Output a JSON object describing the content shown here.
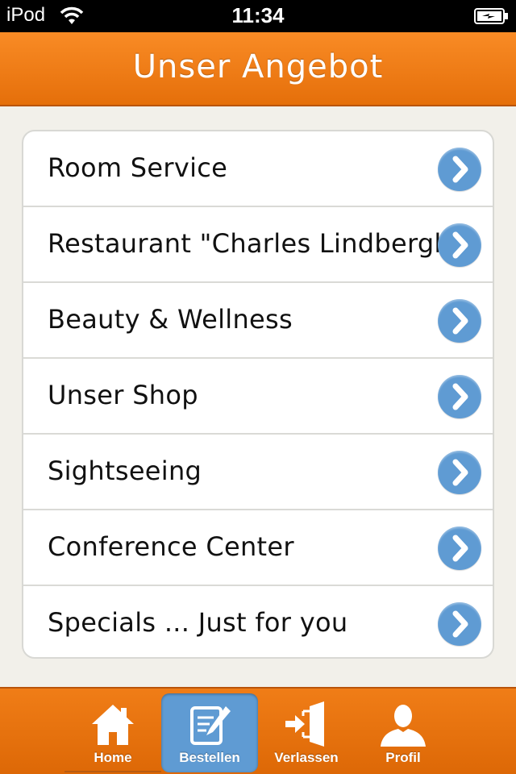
{
  "status_bar": {
    "device": "iPod",
    "time": "11:34"
  },
  "nav": {
    "title": "Unser Angebot"
  },
  "menu": {
    "items": [
      {
        "label": "Room Service"
      },
      {
        "label": "Restaurant \"Charles Lindbergh\""
      },
      {
        "label": "Beauty & Wellness"
      },
      {
        "label": "Unser Shop"
      },
      {
        "label": "Sightseeing"
      },
      {
        "label": "Conference Center"
      },
      {
        "label": "Specials ... Just for you"
      }
    ]
  },
  "tabs": [
    {
      "label": "Home",
      "icon": "home-icon",
      "active": false
    },
    {
      "label": "Bestellen",
      "icon": "order-edit-icon",
      "active": true
    },
    {
      "label": "Verlassen",
      "icon": "exit-icon",
      "active": false
    },
    {
      "label": "Profil",
      "icon": "profile-icon",
      "active": false
    }
  ],
  "colors": {
    "accent": "#f07d17",
    "active_tab": "#5f9bd3",
    "chevron": "#5f9bd3",
    "background": "#f2f0ea"
  }
}
